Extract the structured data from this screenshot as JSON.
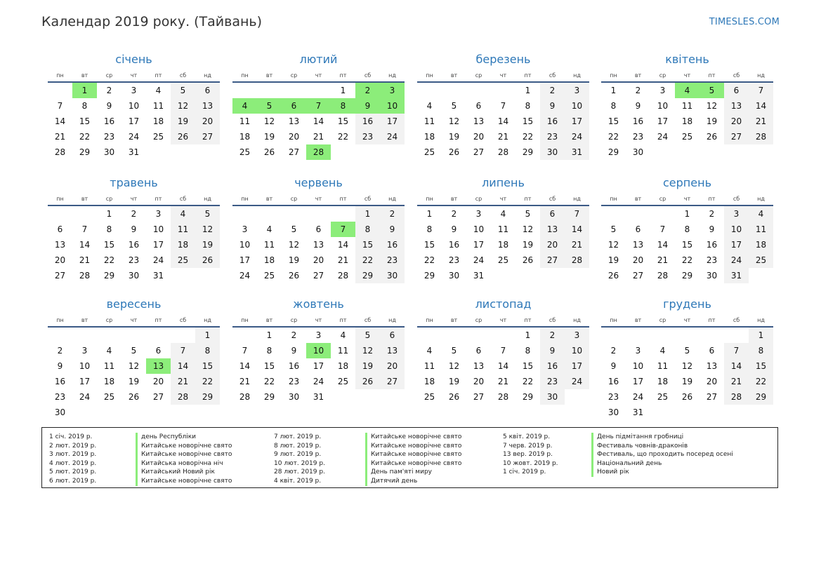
{
  "header": {
    "title": "Календар 2019 року. (Тайвань)",
    "site": "TIMESLES.COM"
  },
  "weekdays": [
    "пн",
    "вт",
    "ср",
    "чт",
    "пт",
    "сб",
    "нд"
  ],
  "months": [
    {
      "name": "січень",
      "offset": 1,
      "days": 31,
      "holidays": [
        1
      ]
    },
    {
      "name": "лютий",
      "offset": 4,
      "days": 28,
      "holidays": [
        2,
        3,
        4,
        5,
        6,
        7,
        8,
        9,
        10,
        28
      ]
    },
    {
      "name": "березень",
      "offset": 4,
      "days": 31,
      "holidays": []
    },
    {
      "name": "квітень",
      "offset": 0,
      "days": 30,
      "holidays": [
        4,
        5
      ]
    },
    {
      "name": "травень",
      "offset": 2,
      "days": 31,
      "holidays": []
    },
    {
      "name": "червень",
      "offset": 5,
      "days": 30,
      "holidays": [
        7
      ]
    },
    {
      "name": "липень",
      "offset": 0,
      "days": 31,
      "holidays": []
    },
    {
      "name": "серпень",
      "offset": 3,
      "days": 31,
      "holidays": []
    },
    {
      "name": "вересень",
      "offset": 6,
      "days": 30,
      "holidays": [
        13
      ]
    },
    {
      "name": "жовтень",
      "offset": 1,
      "days": 31,
      "holidays": [
        10
      ]
    },
    {
      "name": "листопад",
      "offset": 4,
      "days": 30,
      "holidays": []
    },
    {
      "name": "грудень",
      "offset": 6,
      "days": 31,
      "holidays": []
    }
  ],
  "legend": [
    [
      {
        "date": "1 січ. 2019 р.",
        "name": "день Республіки"
      },
      {
        "date": "2 лют. 2019 р.",
        "name": "Китайське новорічне свято"
      },
      {
        "date": "3 лют. 2019 р.",
        "name": "Китайське новорічне свято"
      },
      {
        "date": "4 лют. 2019 р.",
        "name": "Китайська новорічна ніч"
      },
      {
        "date": "5 лют. 2019 р.",
        "name": "Китайський Новий рік"
      },
      {
        "date": "6 лют. 2019 р.",
        "name": "Китайське новорічне свято"
      }
    ],
    [
      {
        "date": "7 лют. 2019 р.",
        "name": "Китайське новорічне свято"
      },
      {
        "date": "8 лют. 2019 р.",
        "name": "Китайське новорічне свято"
      },
      {
        "date": "9 лют. 2019 р.",
        "name": "Китайське новорічне свято"
      },
      {
        "date": "10 лют. 2019 р.",
        "name": "Китайське новорічне свято"
      },
      {
        "date": "28 лют. 2019 р.",
        "name": "День пам'яті миру"
      },
      {
        "date": "4 квіт. 2019 р.",
        "name": "Дитячий день"
      }
    ],
    [
      {
        "date": "5 квіт. 2019 р.",
        "name": "День підмітання гробниці"
      },
      {
        "date": "7 черв. 2019 р.",
        "name": "Фестиваль човнів-драконів"
      },
      {
        "date": "13 вер. 2019 р.",
        "name": "Фестиваль, що проходить посеред осені"
      },
      {
        "date": "10 жовт. 2019 р.",
        "name": "Національний день"
      },
      {
        "date": "1 січ. 2019 р.",
        "name": "Новий рік"
      }
    ]
  ]
}
